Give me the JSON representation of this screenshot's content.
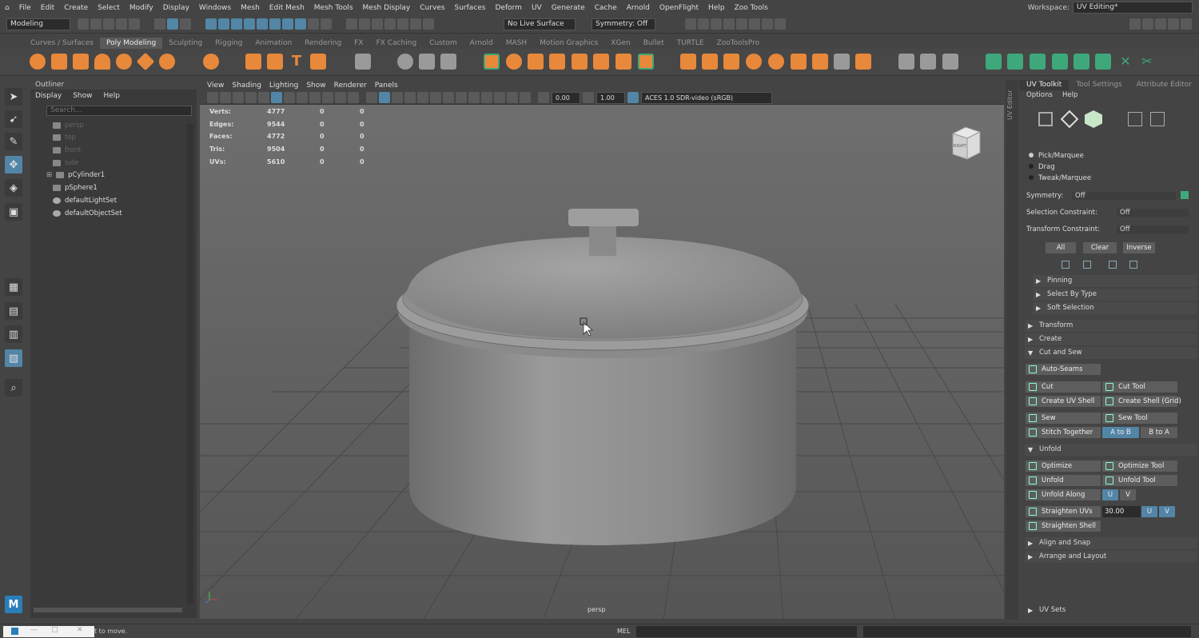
{
  "menubar": {
    "items": [
      "File",
      "Edit",
      "Create",
      "Select",
      "Modify",
      "Display",
      "Windows",
      "Mesh",
      "Edit Mesh",
      "Mesh Tools",
      "Mesh Display",
      "Curves",
      "Surfaces",
      "Deform",
      "UV",
      "Generate",
      "Cache",
      "Arnold",
      "OpenFlight",
      "Help",
      "Zoo Tools"
    ],
    "workspace_label": "Workspace:",
    "workspace_value": "UV Editing*"
  },
  "statusline": {
    "mode": "Modeling",
    "live_surface": "No Live Surface",
    "symmetry": "Symmetry: Off"
  },
  "shelf": {
    "tabs": [
      "Curves / Surfaces",
      "Poly Modeling",
      "Sculpting",
      "Rigging",
      "Animation",
      "Rendering",
      "FX",
      "FX Caching",
      "Custom",
      "Arnold",
      "MASH",
      "Motion Graphics",
      "XGen",
      "Bullet",
      "TURTLE",
      "ZooToolsPro"
    ],
    "active_tab": "Poly Modeling"
  },
  "outliner": {
    "title": "Outliner",
    "menu": [
      "Display",
      "Show",
      "Help"
    ],
    "search_placeholder": "Search...",
    "items": [
      {
        "label": "persp",
        "dim": true
      },
      {
        "label": "top",
        "dim": true
      },
      {
        "label": "front",
        "dim": true
      },
      {
        "label": "side",
        "dim": true
      },
      {
        "label": "pCylinder1",
        "dim": false
      },
      {
        "label": "pSphere1",
        "dim": false
      },
      {
        "label": "defaultLightSet",
        "dim": false
      },
      {
        "label": "defaultObjectSet",
        "dim": false
      }
    ]
  },
  "viewport": {
    "menu": [
      "View",
      "Shading",
      "Lighting",
      "Show",
      "Renderer",
      "Panels"
    ],
    "field1": "0.00",
    "field2": "1.00",
    "colorspace": "ACES 1.0 SDR-video (sRGB)",
    "hud": [
      {
        "label": "Verts:",
        "v": "4777",
        "a": "0",
        "b": "0"
      },
      {
        "label": "Edges:",
        "v": "9544",
        "a": "0",
        "b": "0"
      },
      {
        "label": "Faces:",
        "v": "4772",
        "a": "0",
        "b": "0"
      },
      {
        "label": "Tris:",
        "v": "9504",
        "a": "0",
        "b": "0"
      },
      {
        "label": "UVs:",
        "v": "5610",
        "a": "0",
        "b": "0"
      }
    ],
    "cube_label": "RIGHT",
    "camera_label": "persp"
  },
  "uvpanel": {
    "side_tab": "UV Editor",
    "tabs": [
      "UV Toolkit",
      "Tool Settings",
      "Attribute Editor"
    ],
    "menu": [
      "Options",
      "Help"
    ],
    "select_modes": [
      "Pick/Marquee",
      "Drag",
      "Tweak/Marquee"
    ],
    "symmetry_label": "Symmetry:",
    "symmetry_value": "Off",
    "sel_constraint_label": "Selection Constraint:",
    "sel_constraint_value": "Off",
    "xf_constraint_label": "Transform Constraint:",
    "xf_constraint_value": "Off",
    "btn_all": "All",
    "btn_clear": "Clear",
    "btn_inverse": "Inverse",
    "pinning": "Pinning",
    "select_by_type": "Select By Type",
    "soft_selection": "Soft Selection",
    "transform": "Transform",
    "create": "Create",
    "cut_sew": "Cut and Sew",
    "auto_seams": "Auto-Seams",
    "cut": "Cut",
    "cut_tool": "Cut Tool",
    "create_uv_shell": "Create UV Shell",
    "create_shell_grid": "Create Shell (Grid)",
    "sew": "Sew",
    "sew_tool": "Sew Tool",
    "stitch_together": "Stitch Together",
    "a_to_b": "A to B",
    "b_to_a": "B to A",
    "unfold": "Unfold",
    "optimize": "Optimize",
    "optimize_tool": "Optimize Tool",
    "unfold_btn": "Unfold",
    "unfold_tool": "Unfold Tool",
    "unfold_along": "Unfold Along",
    "u": "U",
    "v": "V",
    "straighten_uvs": "Straighten UVs",
    "straighten_value": "30.00",
    "straighten_shell": "Straighten Shell",
    "align_snap": "Align and Snap",
    "arrange_layout": "Arrange and Layout",
    "uv_sets": "UV Sets"
  },
  "cmdline": {
    "help_text": "t to move.",
    "lang": "MEL"
  },
  "colors": {
    "accent": "#5285a6",
    "shelf_orange": "#e8883a",
    "shelf_green": "#3ea87a"
  }
}
